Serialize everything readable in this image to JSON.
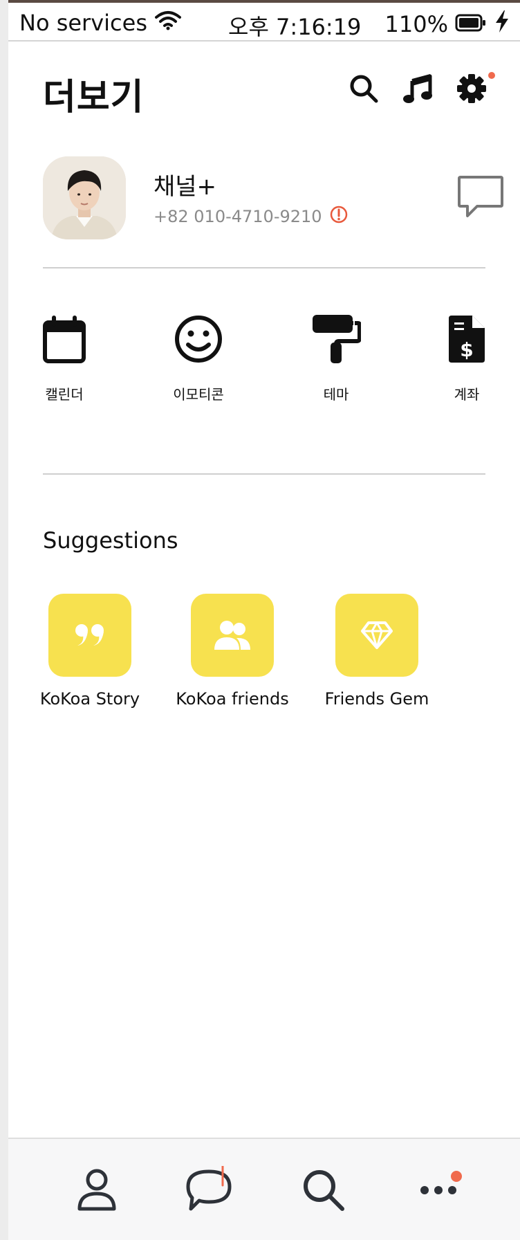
{
  "status_bar": {
    "carrier": "No services",
    "time": "오후 7:16:19",
    "battery": "110%"
  },
  "header": {
    "title": "더보기",
    "icons": [
      "search-icon",
      "music-icon",
      "settings-icon"
    ]
  },
  "profile": {
    "name": "채널+",
    "phone": "+82 010-4710-9210"
  },
  "quick_menu": [
    {
      "label": "캘린더",
      "icon": "calendar-icon"
    },
    {
      "label": "이모티콘",
      "icon": "smiley-icon"
    },
    {
      "label": "테마",
      "icon": "paint-roller-icon"
    },
    {
      "label": "계좌",
      "icon": "invoice-dollar-icon"
    }
  ],
  "suggestions": {
    "title": "Suggestions",
    "items": [
      {
        "label": "KoKoa Story",
        "icon": "quote-icon"
      },
      {
        "label": "KoKoa friends",
        "icon": "people-icon"
      },
      {
        "label": "Friends Gem",
        "icon": "gem-icon"
      }
    ]
  },
  "bottom_nav": {
    "items": [
      "friends-icon",
      "chats-icon",
      "search-icon",
      "more-icon"
    ]
  },
  "colors": {
    "accent_yellow": "#f7e14f",
    "notification": "#f06a4d",
    "warning": "#e8593c"
  }
}
